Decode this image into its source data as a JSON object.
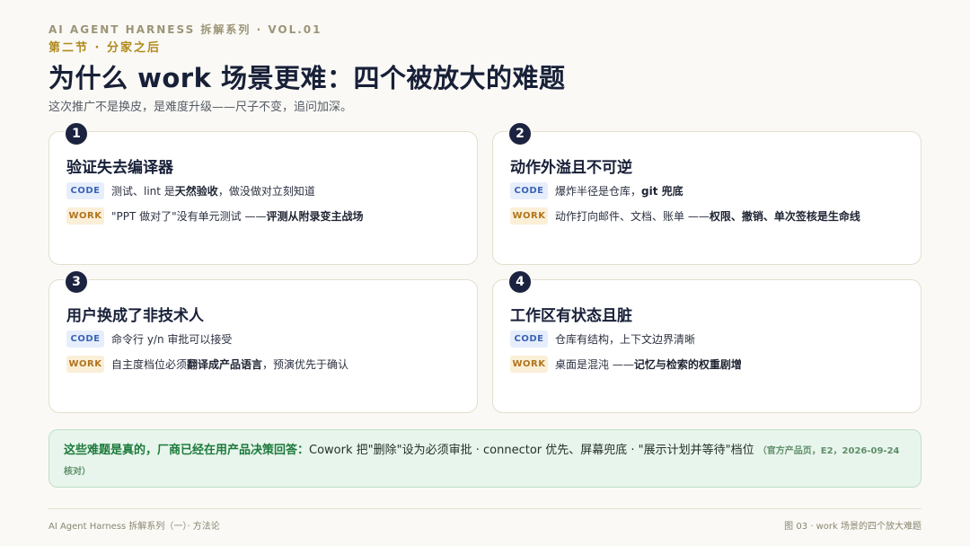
{
  "header": {
    "series": "AI AGENT HARNESS 拆解系列 · VOL.01",
    "section": "第二节 · 分家之后",
    "title": "为什么 work 场景更难：四个被放大的难题",
    "subtitle": "这次推广不是换皮，是难度升级——尺子不变，追问加深。"
  },
  "cards": [
    {
      "number": "1",
      "title": "验证失去编译器",
      "code_tag": "CODE",
      "code_text": "测试、lint 是",
      "code_bold": "天然验收",
      "code_after": "，做没做对立刻知道",
      "work_tag": "WORK",
      "work_text": "\"PPT 做对了\"没有单元测试 —— ",
      "work_bold": "评测从附录变主战场",
      "work_after": ""
    },
    {
      "number": "2",
      "title": "动作外溢且不可逆",
      "code_tag": "CODE",
      "code_text": "爆炸半径是仓库，",
      "code_bold": "git 兜底",
      "code_after": "",
      "work_tag": "WORK",
      "work_text": "动作打向邮件、文档、账单 —— ",
      "work_bold": "权限、撤销、单次签核是生命线",
      "work_after": ""
    },
    {
      "number": "3",
      "title": "用户换成了非技术人",
      "code_tag": "CODE",
      "code_text": "命令行 y/n 审批可以接受",
      "code_bold": "",
      "code_after": "",
      "work_tag": "WORK",
      "work_text": "自主度档位必须",
      "work_bold": "翻译成产品语言",
      "work_after": "，预演优先于确认"
    },
    {
      "number": "4",
      "title": "工作区有状态且脏",
      "code_tag": "CODE",
      "code_text": "仓库有结构，上下文边界清晰",
      "code_bold": "",
      "code_after": "",
      "work_tag": "WORK",
      "work_text": "桌面是混沌 —— ",
      "work_bold": "记忆与检索的权重剧增",
      "work_after": ""
    }
  ],
  "note": {
    "lead": "这些难题是真的，厂商已经在用产品决策回答：",
    "body": "Cowork 把\"删除\"设为必须审批 · connector 优先、屏幕兜底 · \"展示计划并等待\"档位 ",
    "source": "（官方产品页，E2，2026-09-24 核对）"
  },
  "footer": {
    "left": "AI Agent Harness 拆解系列（一）· 方法论",
    "right": "图 03 · work 场景的四个放大难题"
  }
}
